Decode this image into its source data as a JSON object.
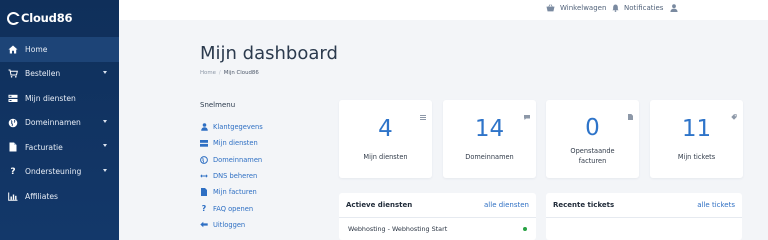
{
  "brand": {
    "name": "Cloud86"
  },
  "sidebar": {
    "items": [
      {
        "label": "Home",
        "icon": "home-icon",
        "active": true,
        "has_caret": false
      },
      {
        "label": "Bestellen",
        "icon": "cart-icon",
        "active": false,
        "has_caret": true
      },
      {
        "label": "Mijn diensten",
        "icon": "server-icon",
        "active": false,
        "has_caret": false
      },
      {
        "label": "Domeinnamen",
        "icon": "globe-icon",
        "active": false,
        "has_caret": true
      },
      {
        "label": "Facturatie",
        "icon": "invoice-icon",
        "active": false,
        "has_caret": true
      },
      {
        "label": "Ondersteuning",
        "icon": "question-icon",
        "active": false,
        "has_caret": true
      },
      {
        "label": "Affiliates",
        "icon": "chart-icon",
        "active": false,
        "has_caret": false
      }
    ]
  },
  "topbar": {
    "cart_label": "Winkelwagen",
    "notifications_label": "Notificaties"
  },
  "page": {
    "title": "Mijn dashboard",
    "breadcrumb_home": "Home",
    "breadcrumb_current": "Mijn Cloud86"
  },
  "snelmenu": {
    "title": "Snelmenu",
    "items": [
      {
        "label": "Klantgegevens",
        "icon": "user-icon"
      },
      {
        "label": "Mijn diensten",
        "icon": "server-icon"
      },
      {
        "label": "Domeinnamen",
        "icon": "globe-icon"
      },
      {
        "label": "DNS beheren",
        "icon": "arrows-icon"
      },
      {
        "label": "Mijn facturen",
        "icon": "invoice-icon"
      },
      {
        "label": "FAQ openen",
        "icon": "question-icon"
      },
      {
        "label": "Uitloggen",
        "icon": "logout-icon"
      }
    ]
  },
  "stats": [
    {
      "value": "4",
      "label": "Mijn diensten",
      "label2": "",
      "icon": "list-icon"
    },
    {
      "value": "14",
      "label": "Domeinnamen",
      "label2": "",
      "icon": "comment-icon"
    },
    {
      "value": "0",
      "label": "Openstaande",
      "label2": "facturen",
      "icon": "file-icon"
    },
    {
      "value": "11",
      "label": "Mijn tickets",
      "label2": "",
      "icon": "tag-icon"
    }
  ],
  "services_panel": {
    "title": "Actieve diensten",
    "link": "alle diensten",
    "rows": [
      {
        "name": "Webhosting - Webhosting Start",
        "status_color": "#27a243"
      }
    ]
  },
  "tickets_panel": {
    "title": "Recente tickets",
    "link": "alle tickets"
  },
  "colors": {
    "sidebar": "#0f2f5a",
    "accent": "#2e74c9",
    "status_active": "#27a243"
  }
}
